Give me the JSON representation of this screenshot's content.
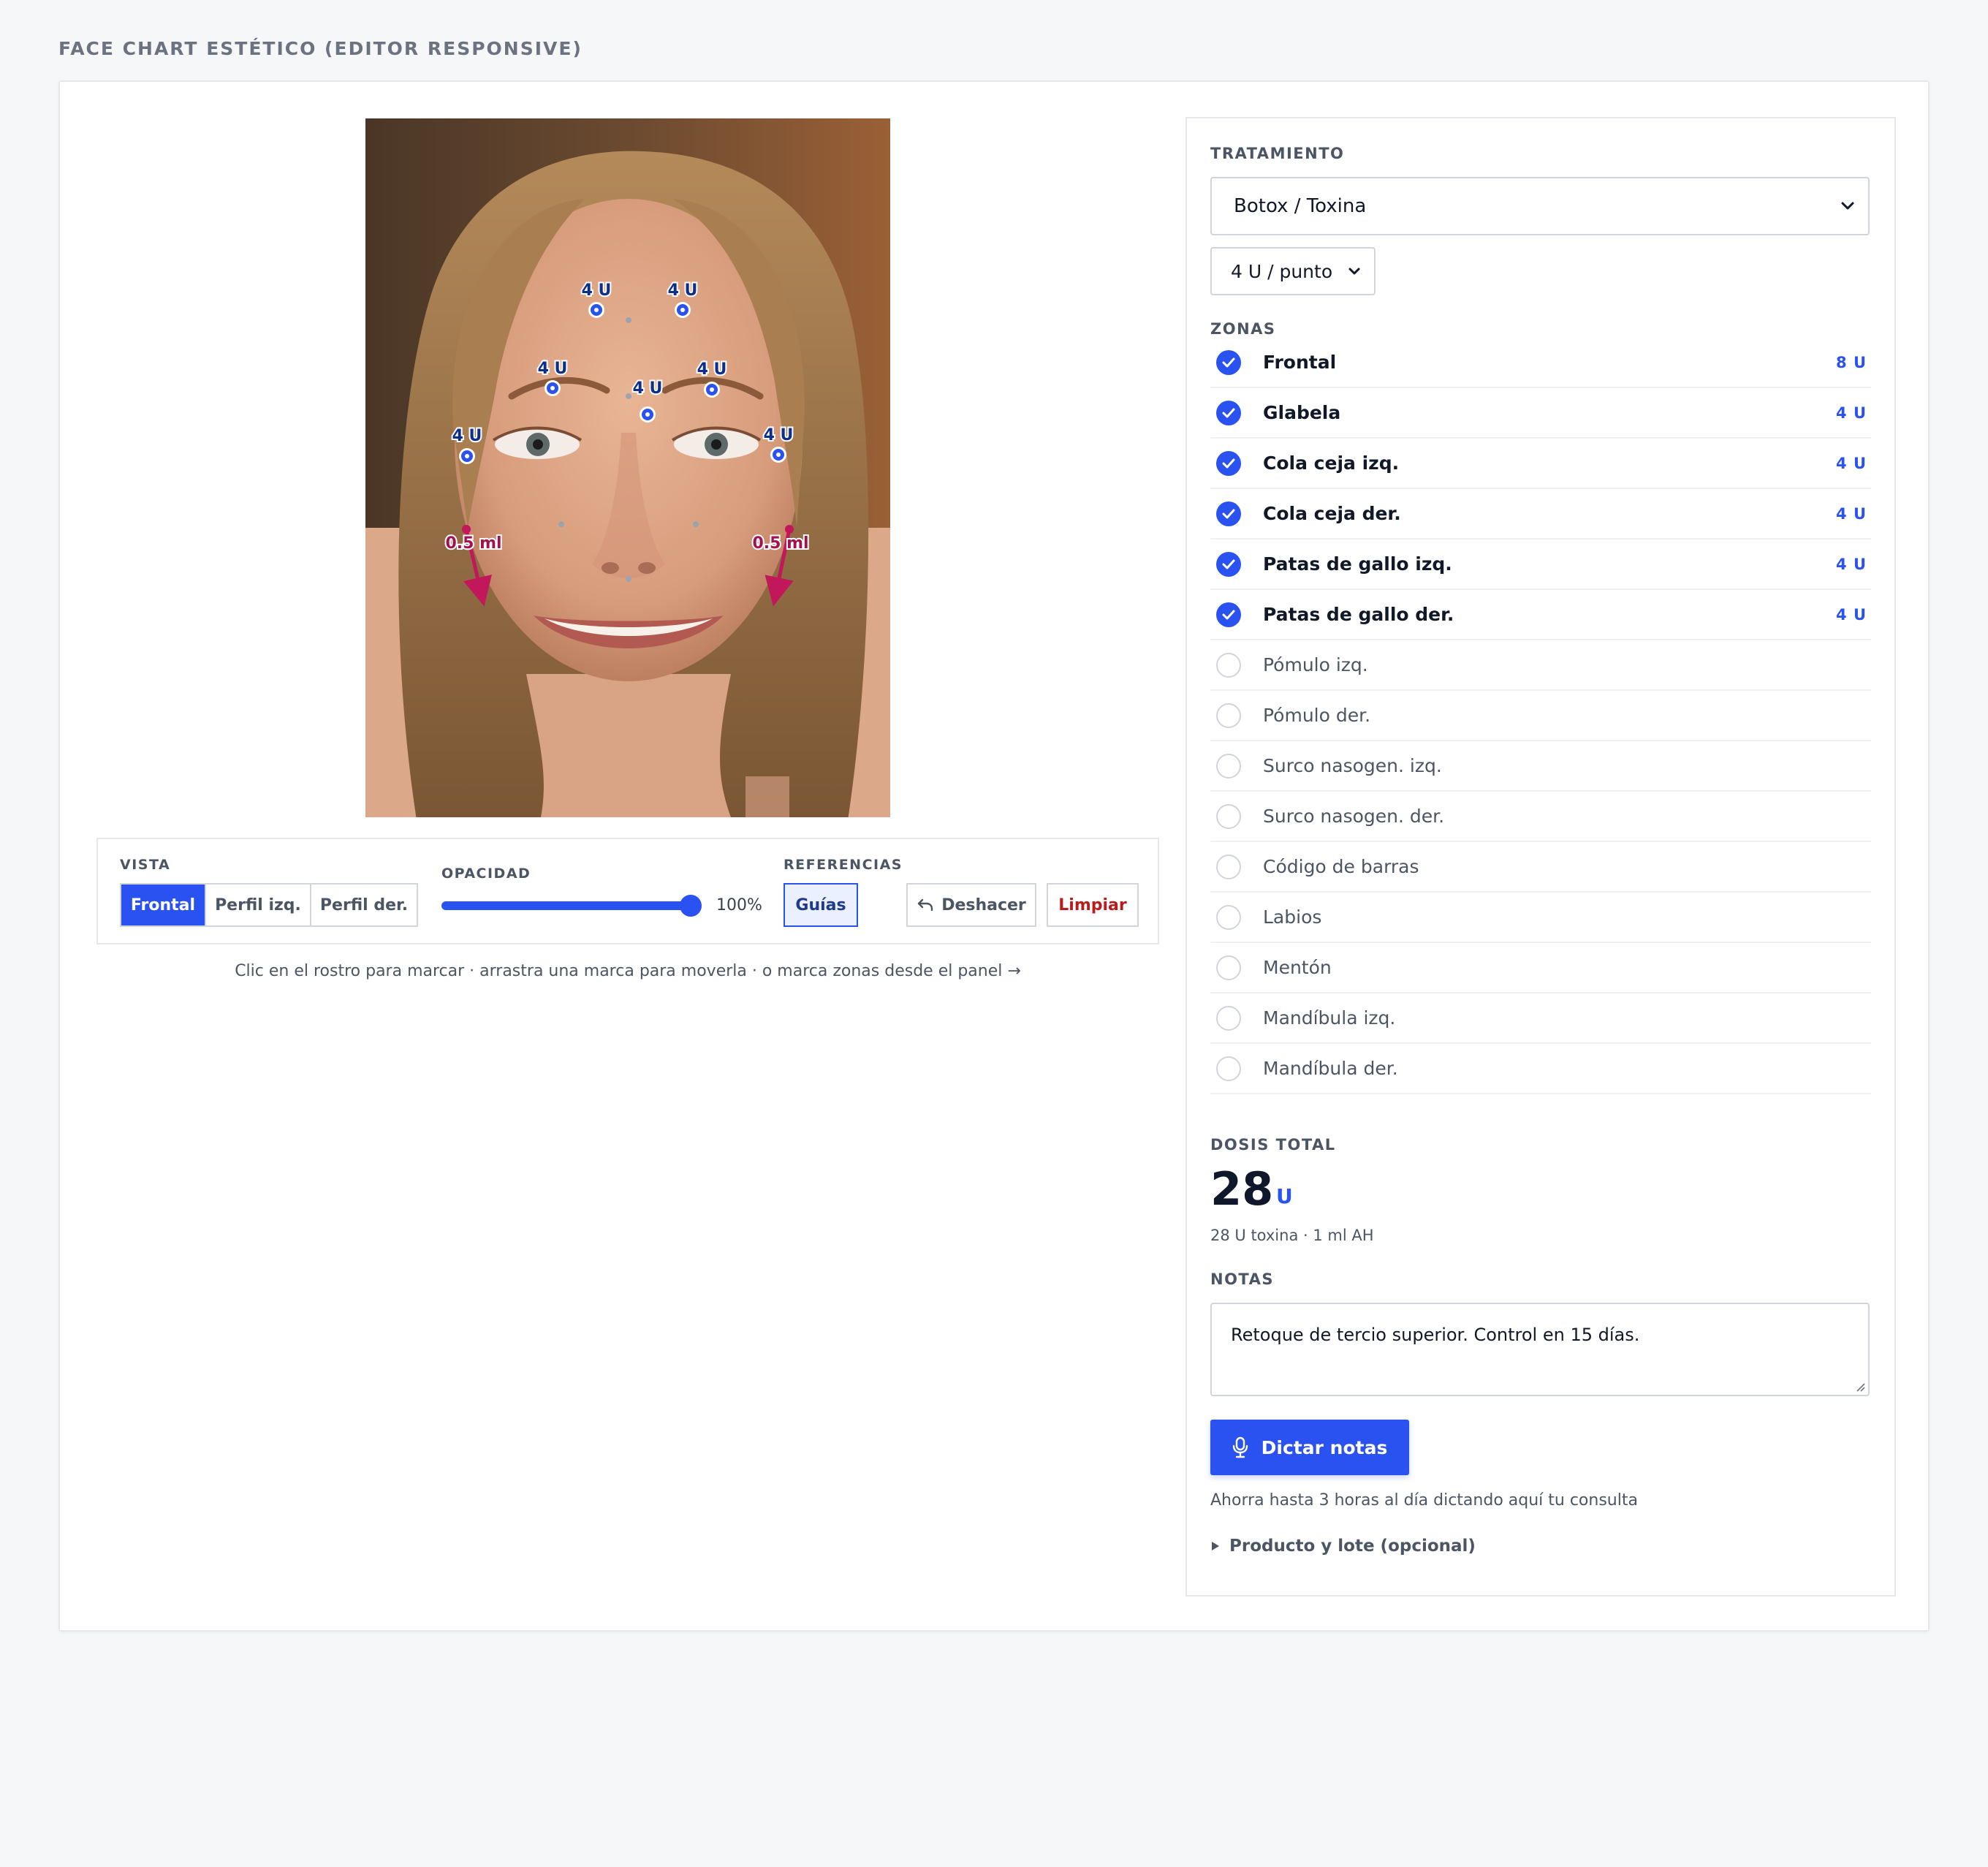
{
  "page": {
    "title": "FACE CHART ESTÉTICO (EDITOR RESPONSIVE)"
  },
  "face_marks": {
    "toxin_label": "4 U",
    "filler_label": "0.5 ml"
  },
  "toolbar": {
    "view_label": "VISTA",
    "views": [
      "Frontal",
      "Perfil izq.",
      "Perfil der."
    ],
    "active_view": "Frontal",
    "opacity_label": "OPACIDAD",
    "opacity_value": "100%",
    "opacity_level": 1.0,
    "references_label": "REFERENCIAS",
    "guides_label": "Guías",
    "undo_label": "Deshacer",
    "clear_label": "Limpiar"
  },
  "hint": "Clic en el rostro para marcar · arrastra una marca para moverla · o marca zonas desde el panel →",
  "panel": {
    "treatment_label": "TRATAMIENTO",
    "treatment_value": "Botox / Toxina",
    "dose_per_point": "4 U / punto",
    "zones_label": "ZONAS",
    "zones": [
      {
        "name": "Frontal",
        "selected": true,
        "dose": "8 U"
      },
      {
        "name": "Glabela",
        "selected": true,
        "dose": "4 U"
      },
      {
        "name": "Cola ceja izq.",
        "selected": true,
        "dose": "4 U"
      },
      {
        "name": "Cola ceja der.",
        "selected": true,
        "dose": "4 U"
      },
      {
        "name": "Patas de gallo izq.",
        "selected": true,
        "dose": "4 U"
      },
      {
        "name": "Patas de gallo der.",
        "selected": true,
        "dose": "4 U"
      },
      {
        "name": "Pómulo izq.",
        "selected": false,
        "dose": ""
      },
      {
        "name": "Pómulo der.",
        "selected": false,
        "dose": ""
      },
      {
        "name": "Surco nasogen. izq.",
        "selected": false,
        "dose": ""
      },
      {
        "name": "Surco nasogen. der.",
        "selected": false,
        "dose": ""
      },
      {
        "name": "Código de barras",
        "selected": false,
        "dose": ""
      },
      {
        "name": "Labios",
        "selected": false,
        "dose": ""
      },
      {
        "name": "Mentón",
        "selected": false,
        "dose": ""
      },
      {
        "name": "Mandíbula izq.",
        "selected": false,
        "dose": ""
      },
      {
        "name": "Mandíbula der.",
        "selected": false,
        "dose": ""
      }
    ],
    "total_label": "DOSIS TOTAL",
    "total_value": "28",
    "total_unit": "U",
    "total_sub": "28 U toxina · 1 ml AH",
    "notes_label": "NOTAS",
    "notes_value": "Retoque de tercio superior. Control en 15 días.",
    "dictate_label": "Dictar notas",
    "dictate_hint": "Ahorra hasta 3 horas al día dictando aquí tu consulta",
    "product_label": "Producto y lote (opcional)"
  },
  "colors": {
    "accent": "#2952f0",
    "filler": "#c2185b",
    "danger": "#b91c1c"
  },
  "icons": {
    "undo": "undo-icon",
    "mic": "microphone-icon",
    "chevron": "chevron-down-icon",
    "check": "check-icon",
    "disclosure": "triangle-right-icon"
  }
}
